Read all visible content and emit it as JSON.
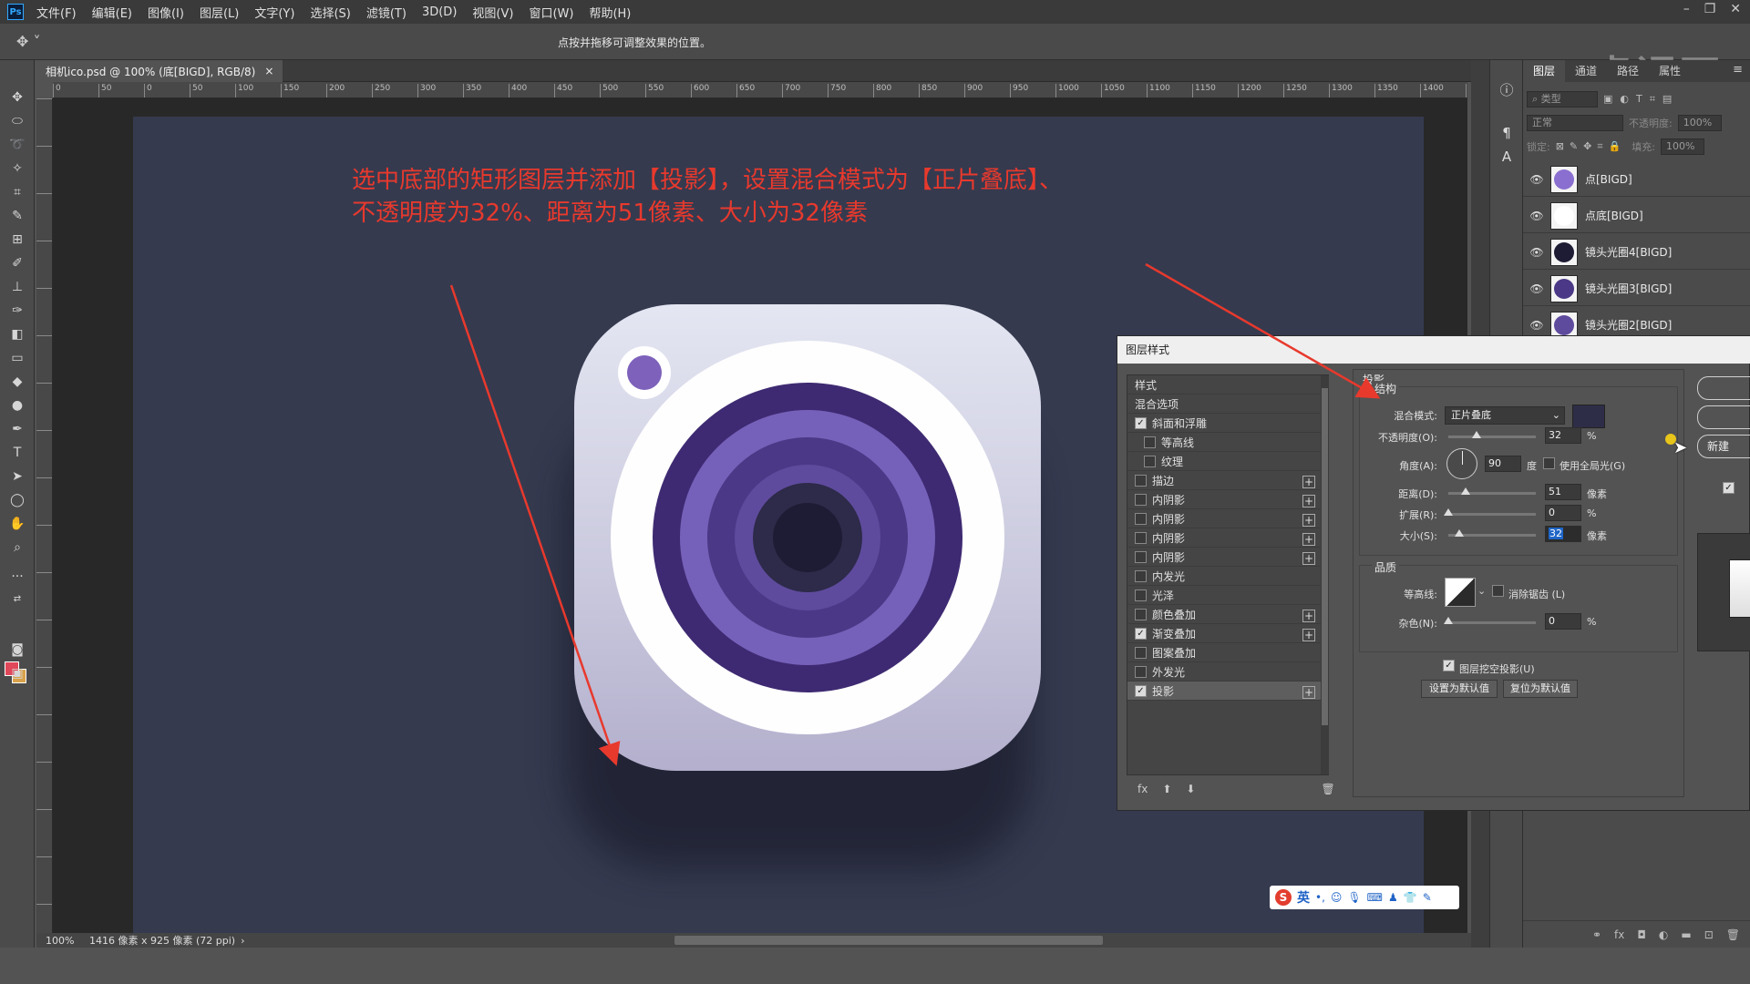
{
  "menubar": {
    "logo": "Ps",
    "items": [
      "文件(F)",
      "编辑(E)",
      "图像(I)",
      "图层(L)",
      "文字(Y)",
      "选择(S)",
      "滤镜(T)",
      "3D(D)",
      "视图(V)",
      "窗口(W)",
      "帮助(H)"
    ]
  },
  "options_bar": {
    "hint": "点按并拖移可调整效果的位置。"
  },
  "watermark": "虎课网",
  "document": {
    "tab_title": "相机ico.psd @ 100% (底[BIGD], RGB/8)",
    "tab_close": "×",
    "ruler_labels": [
      "0",
      "50",
      "0",
      "50",
      "100",
      "150",
      "200",
      "250",
      "300",
      "350",
      "400",
      "450",
      "500",
      "550",
      "600",
      "650",
      "700",
      "750",
      "800",
      "850",
      "900",
      "950",
      "1000",
      "1050",
      "1100",
      "1150",
      "1200",
      "1250",
      "1300",
      "1350",
      "1400",
      "14"
    ]
  },
  "canvas": {
    "instruction_line1": "选中底部的矩形图层并添加【投影】，设置混合模式为【正片叠底】、",
    "instruction_line2": "不透明度为32%、距离为51像素、大小为32像素"
  },
  "statusbar": {
    "zoom": "100%",
    "doc_info": "1416 像素 x 925 像素 (72 ppi)",
    "arrow": "›"
  },
  "ime": {
    "lang": "英",
    "logo": "S"
  },
  "layers_panel": {
    "tabs": [
      "图层",
      "通道",
      "路径",
      "属性"
    ],
    "filter_placeholder": "类型",
    "blend_mode": "正常",
    "opacity_label": "不透明度:",
    "opacity_value": "100%",
    "lock_label": "锁定:",
    "fill_label": "填充:",
    "fill_value": "100%",
    "layers": [
      {
        "name": "点[BIGD]",
        "thumb_color": "#8a6fd0"
      },
      {
        "name": "点底[BIGD]",
        "thumb_color": "#ffffff"
      },
      {
        "name": "镜头光圈4[BIGD]",
        "thumb_color": "#1e1c34"
      },
      {
        "name": "镜头光圈3[BIGD]",
        "thumb_color": "#4b3886"
      },
      {
        "name": "镜头光圈2[BIGD]",
        "thumb_color": "#5f4b9d"
      }
    ]
  },
  "layer_style_dialog": {
    "title": "图层样式",
    "style_list": [
      {
        "label": "样式",
        "checkbox": false,
        "checked": false,
        "plus": false,
        "indent": false,
        "header": true
      },
      {
        "label": "混合选项",
        "checkbox": false,
        "checked": false,
        "plus": false,
        "indent": false,
        "header": true
      },
      {
        "label": "斜面和浮雕",
        "checkbox": true,
        "checked": true,
        "plus": false,
        "indent": false
      },
      {
        "label": "等高线",
        "checkbox": true,
        "checked": false,
        "plus": false,
        "indent": true
      },
      {
        "label": "纹理",
        "checkbox": true,
        "checked": false,
        "plus": false,
        "indent": true
      },
      {
        "label": "描边",
        "checkbox": true,
        "checked": false,
        "plus": true,
        "indent": false
      },
      {
        "label": "内阴影",
        "checkbox": true,
        "checked": false,
        "plus": true,
        "indent": false
      },
      {
        "label": "内阴影",
        "checkbox": true,
        "checked": false,
        "plus": true,
        "indent": false
      },
      {
        "label": "内阴影",
        "checkbox": true,
        "checked": false,
        "plus": true,
        "indent": false
      },
      {
        "label": "内阴影",
        "checkbox": true,
        "checked": false,
        "plus": true,
        "indent": false
      },
      {
        "label": "内发光",
        "checkbox": true,
        "checked": false,
        "plus": false,
        "indent": false
      },
      {
        "label": "光泽",
        "checkbox": true,
        "checked": false,
        "plus": false,
        "indent": false
      },
      {
        "label": "颜色叠加",
        "checkbox": true,
        "checked": false,
        "plus": true,
        "indent": false
      },
      {
        "label": "渐变叠加",
        "checkbox": true,
        "checked": true,
        "plus": true,
        "indent": false
      },
      {
        "label": "图案叠加",
        "checkbox": true,
        "checked": false,
        "plus": false,
        "indent": false
      },
      {
        "label": "外发光",
        "checkbox": true,
        "checked": false,
        "plus": false,
        "indent": false
      },
      {
        "label": "投影",
        "checkbox": true,
        "checked": true,
        "plus": true,
        "indent": false,
        "selected": true
      }
    ],
    "footer_fx": "fx",
    "section_title": "投影",
    "structure_title": "结构",
    "blend_mode_label": "混合模式:",
    "blend_mode_value": "正片叠底",
    "shadow_color": "#2e2d48",
    "opacity_label": "不透明度(O):",
    "opacity_value": "32",
    "opacity_fraction": 0.32,
    "percent": "%",
    "angle_label": "角度(A):",
    "angle_value": "90",
    "degree": "度",
    "global_light_label": "使用全局光(G)",
    "distance_label": "距离(D):",
    "distance_value": "51",
    "distance_fraction": 0.2,
    "spread_label": "扩展(R):",
    "spread_value": "0",
    "size_label": "大小(S):",
    "size_value": "32",
    "size_fraction": 0.13,
    "pixels": "像素",
    "quality_title": "品质",
    "contour_label": "等高线:",
    "antialias_label": "消除锯齿 (L)",
    "noise_label": "杂色(N):",
    "noise_value": "0",
    "knockout_label": "图层挖空投影(U)",
    "set_default": "设置为默认值",
    "reset_default": "复位为默认值",
    "right_buttons": [
      "",
      "",
      "新建"
    ]
  }
}
